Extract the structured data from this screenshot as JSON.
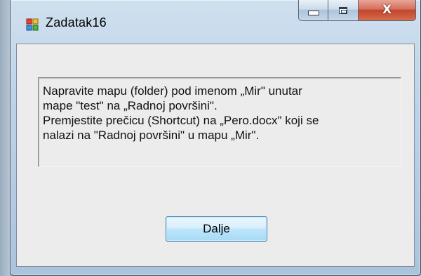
{
  "window": {
    "title": "Zadatak16",
    "icon": "app-window-icon",
    "caption_buttons": {
      "minimize_icon": "minimize-icon",
      "maximize_icon": "maximize-icon",
      "close_icon": "close-icon",
      "close_glyph": "X"
    }
  },
  "message": {
    "text": "Napravite mapu (folder) pod imenom „Mir\" unutar\nmape \"test\" na  „Radnoj površini\".\nPremjestite prečicu (Shortcut) na „Pero.docx\" koji se\nnalazi na \"Radnoj površini\" u mapu „Mir\"."
  },
  "buttons": {
    "next_label": "Dalje"
  },
  "colors": {
    "client_background": "#ececec",
    "close_button": "#c2442c",
    "button_border": "#3c7fb1"
  }
}
